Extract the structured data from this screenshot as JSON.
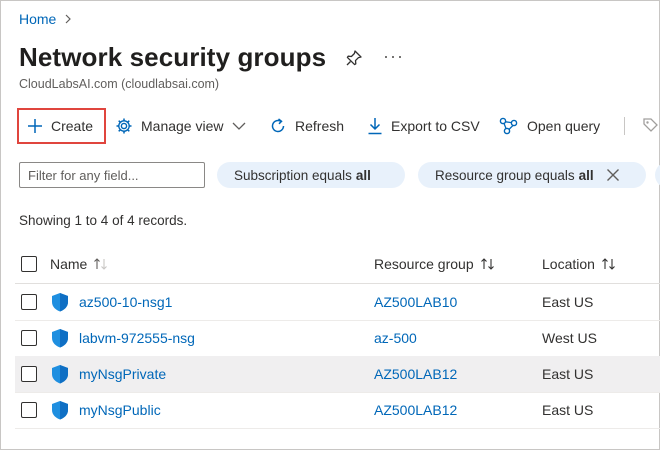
{
  "breadcrumb": {
    "home": "Home"
  },
  "page": {
    "title": "Network security groups",
    "subtitle": "CloudLabsAI.com (cloudlabsai.com)"
  },
  "toolbar": {
    "create": "Create",
    "manage_view": "Manage view",
    "refresh": "Refresh",
    "export_csv": "Export to CSV",
    "open_query": "Open query"
  },
  "filters": {
    "search_placeholder": "Filter for any field...",
    "subscription": {
      "label": "Subscription equals",
      "value": "all"
    },
    "resource_group": {
      "label": "Resource group equals",
      "value": "all"
    }
  },
  "records_text": "Showing 1 to 4 of 4 records.",
  "table": {
    "columns": {
      "name": "Name",
      "resource_group": "Resource group",
      "location": "Location"
    },
    "rows": [
      {
        "name": "az500-10-nsg1",
        "resource_group": "AZ500LAB10",
        "location": "East US"
      },
      {
        "name": "labvm-972555-nsg",
        "resource_group": "az-500",
        "location": "West US"
      },
      {
        "name": "myNsgPrivate",
        "resource_group": "AZ500LAB12",
        "location": "East US"
      },
      {
        "name": "myNsgPublic",
        "resource_group": "AZ500LAB12",
        "location": "East US"
      }
    ]
  },
  "colors": {
    "link": "#0067b8",
    "highlight_border": "#e0453e",
    "pill_bg": "#e8f1fb",
    "row_hover": "#f0eff0"
  },
  "icons": [
    "chevron-right-icon",
    "pin-icon",
    "more-icon",
    "plus-icon",
    "gear-icon",
    "chevron-down-icon",
    "refresh-icon",
    "download-icon",
    "query-icon",
    "close-icon",
    "sort-icon",
    "shield-icon",
    "tag-icon"
  ]
}
